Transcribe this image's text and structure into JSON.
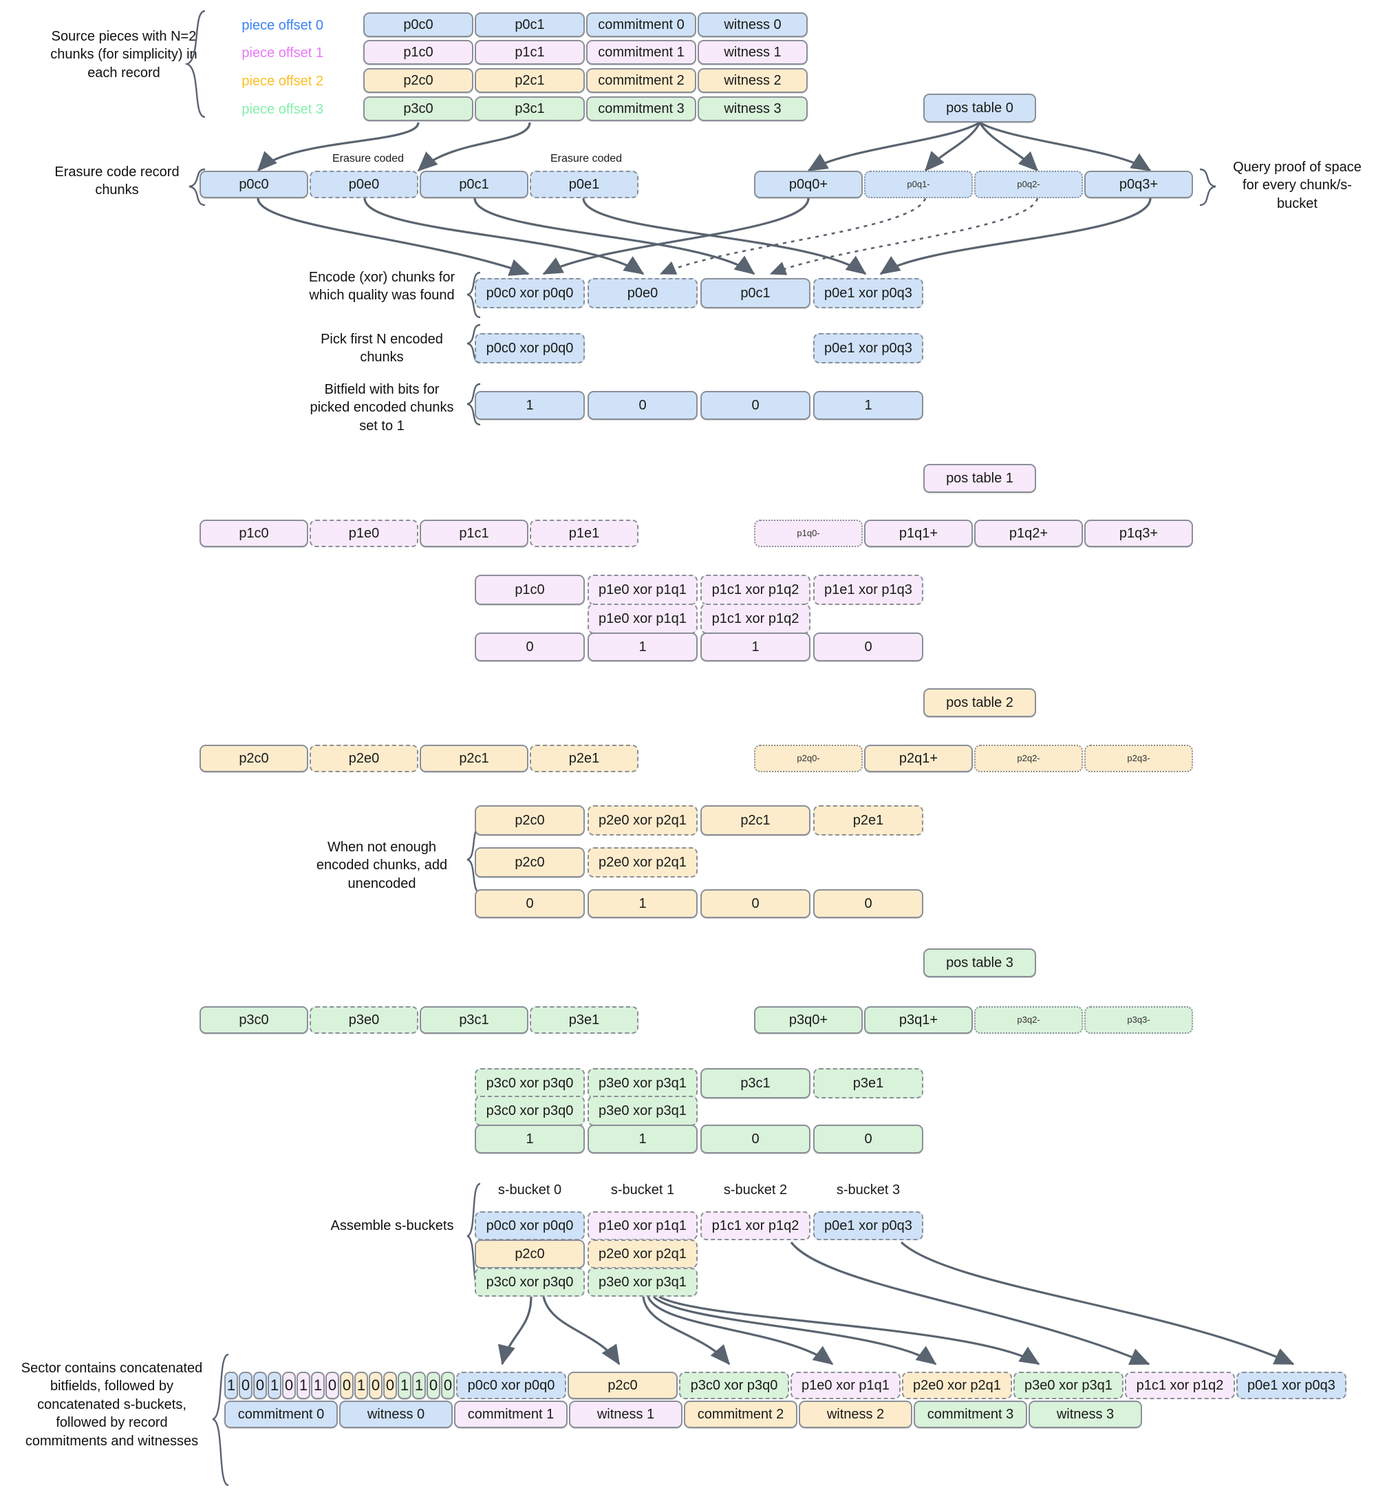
{
  "palette": {
    "blue": "#cfe2f7",
    "pink": "#f8eafa",
    "orange": "#fdeccc",
    "green": "#d9f2da",
    "stroke": "#8a8f98",
    "arrow": "#5a6470",
    "offset0_text": "#3b82f6",
    "offset1_text": "#e879f9",
    "offset2_text": "#fbbf24",
    "offset3_text": "#86efac"
  },
  "labels": {
    "source_pieces": "Source pieces with N=2 chunks (for simplicity) in each record",
    "erasure_code_record_chunks": "Erasure code record chunks",
    "query_proof_of_space": "Query proof of space for every chunk/s-bucket",
    "encode_xor": "Encode (xor) chunks for which quality was found",
    "pick_first_n": "Pick first N encoded chunks",
    "bitfield_label": "Bitfield with bits for picked encoded chunks set to 1",
    "when_not_enough": "When not enough encoded chunks, add unencoded",
    "assemble_s_buckets": "Assemble s-buckets",
    "sector_contains": "Sector contains concatenated bitfields, followed by concatenated s-buckets, followed by record commitments and witnesses",
    "erasure_coded": "Erasure coded"
  },
  "piece_offsets": [
    {
      "label": "piece offset 0",
      "color": "offset0_text"
    },
    {
      "label": "piece offset 1",
      "color": "offset1_text"
    },
    {
      "label": "piece offset 2",
      "color": "offset2_text"
    },
    {
      "label": "piece offset 3",
      "color": "offset3_text"
    }
  ],
  "records": [
    {
      "tone": "blue",
      "cells": [
        "p0c0",
        "p0c1",
        "commitment 0",
        "witness 0"
      ]
    },
    {
      "tone": "pink",
      "cells": [
        "p1c0",
        "p1c1",
        "commitment 1",
        "witness 1"
      ]
    },
    {
      "tone": "orange",
      "cells": [
        "p2c0",
        "p2c1",
        "commitment 2",
        "witness 2"
      ]
    },
    {
      "tone": "green",
      "cells": [
        "p3c0",
        "p3c1",
        "commitment 3",
        "witness 3"
      ]
    }
  ],
  "pos_tables": [
    {
      "label": "pos table 0",
      "tone": "blue"
    },
    {
      "label": "pos table 1",
      "tone": "pink"
    },
    {
      "label": "pos table 2",
      "tone": "orange"
    },
    {
      "label": "pos table 3",
      "tone": "green"
    }
  ],
  "groups": [
    {
      "id": "group0",
      "tone": "blue",
      "chunks": [
        {
          "text": "p0c0",
          "style": "solid"
        },
        {
          "text": "p0e0",
          "style": "dashed"
        },
        {
          "text": "p0c1",
          "style": "solid"
        },
        {
          "text": "p0e1",
          "style": "dashed"
        }
      ],
      "quality": [
        {
          "text": "p0q0+",
          "style": "solid",
          "size": "normal"
        },
        {
          "text": "p0q1-",
          "style": "dotted",
          "size": "small"
        },
        {
          "text": "p0q2-",
          "style": "dotted",
          "size": "small"
        },
        {
          "text": "p0q3+",
          "style": "solid",
          "size": "normal"
        }
      ],
      "encoded": [
        {
          "text": "p0c0 xor p0q0",
          "style": "dashed"
        },
        {
          "text": "p0e0",
          "style": "dashed"
        },
        {
          "text": "p0c1",
          "style": "solid"
        },
        {
          "text": "p0e1 xor p0q3",
          "style": "dashed"
        }
      ],
      "picked": [
        {
          "text": "p0c0 xor p0q0",
          "style": "dashed",
          "slot": 0
        },
        {
          "text": "p0e1 xor p0q3",
          "style": "dashed",
          "slot": 3
        }
      ],
      "bitfield": [
        "1",
        "0",
        "0",
        "1"
      ]
    },
    {
      "id": "group1",
      "tone": "pink",
      "chunks": [
        {
          "text": "p1c0",
          "style": "solid"
        },
        {
          "text": "p1e0",
          "style": "dashed"
        },
        {
          "text": "p1c1",
          "style": "solid"
        },
        {
          "text": "p1e1",
          "style": "dashed"
        }
      ],
      "quality": [
        {
          "text": "p1q0-",
          "style": "dotted",
          "size": "small"
        },
        {
          "text": "p1q1+",
          "style": "solid",
          "size": "normal"
        },
        {
          "text": "p1q2+",
          "style": "solid",
          "size": "normal"
        },
        {
          "text": "p1q3+",
          "style": "solid",
          "size": "normal"
        }
      ],
      "encoded": [
        {
          "text": "p1c0",
          "style": "solid"
        },
        {
          "text": "p1e0 xor p1q1",
          "style": "dashed"
        },
        {
          "text": "p1c1 xor p1q2",
          "style": "dashed"
        },
        {
          "text": "p1e1 xor p1q3",
          "style": "dashed"
        }
      ],
      "picked": [
        {
          "text": "p1e0 xor p1q1",
          "style": "dashed",
          "slot": 1
        },
        {
          "text": "p1c1 xor p1q2",
          "style": "dashed",
          "slot": 2
        }
      ],
      "bitfield": [
        "0",
        "1",
        "1",
        "0"
      ]
    },
    {
      "id": "group2",
      "tone": "orange",
      "chunks": [
        {
          "text": "p2c0",
          "style": "solid"
        },
        {
          "text": "p2e0",
          "style": "dashed"
        },
        {
          "text": "p2c1",
          "style": "solid"
        },
        {
          "text": "p2e1",
          "style": "dashed"
        }
      ],
      "quality": [
        {
          "text": "p2q0-",
          "style": "dotted",
          "size": "small"
        },
        {
          "text": "p2q1+",
          "style": "solid",
          "size": "normal"
        },
        {
          "text": "p2q2-",
          "style": "dotted",
          "size": "small"
        },
        {
          "text": "p2q3-",
          "style": "dotted",
          "size": "small"
        }
      ],
      "encoded": [
        {
          "text": "p2c0",
          "style": "solid"
        },
        {
          "text": "p2e0 xor p2q1",
          "style": "dashed"
        },
        {
          "text": "p2c1",
          "style": "solid"
        },
        {
          "text": "p2e1",
          "style": "dashed"
        }
      ],
      "picked": [
        {
          "text": "p2c0",
          "style": "solid",
          "slot": 0
        },
        {
          "text": "p2e0 xor p2q1",
          "style": "dashed",
          "slot": 1
        }
      ],
      "bitfield": [
        "0",
        "1",
        "0",
        "0"
      ]
    },
    {
      "id": "group3",
      "tone": "green",
      "chunks": [
        {
          "text": "p3c0",
          "style": "solid"
        },
        {
          "text": "p3e0",
          "style": "dashed"
        },
        {
          "text": "p3c1",
          "style": "solid"
        },
        {
          "text": "p3e1",
          "style": "dashed"
        }
      ],
      "quality": [
        {
          "text": "p3q0+",
          "style": "solid",
          "size": "normal"
        },
        {
          "text": "p3q1+",
          "style": "solid",
          "size": "normal"
        },
        {
          "text": "p3q2-",
          "style": "dotted",
          "size": "small"
        },
        {
          "text": "p3q3-",
          "style": "dotted",
          "size": "small"
        }
      ],
      "encoded": [
        {
          "text": "p3c0 xor p3q0",
          "style": "dashed"
        },
        {
          "text": "p3e0 xor p3q1",
          "style": "dashed"
        },
        {
          "text": "p3c1",
          "style": "solid"
        },
        {
          "text": "p3e1",
          "style": "dashed"
        }
      ],
      "picked": [
        {
          "text": "p3c0 xor p3q0",
          "style": "dashed",
          "slot": 0
        },
        {
          "text": "p3e0 xor p3q1",
          "style": "dashed",
          "slot": 1
        }
      ],
      "bitfield": [
        "1",
        "1",
        "0",
        "0"
      ]
    }
  ],
  "s_buckets": {
    "headers": [
      "s-bucket 0",
      "s-bucket 1",
      "s-bucket 2",
      "s-bucket 3"
    ],
    "rows": [
      [
        {
          "text": "p0c0 xor p0q0",
          "tone": "blue",
          "style": "dashed"
        },
        {
          "text": "p1e0 xor p1q1",
          "tone": "pink",
          "style": "dashed"
        },
        {
          "text": "p1c1  xor p1q2",
          "tone": "pink",
          "style": "dashed"
        },
        {
          "text": "p0e1 xor p0q3",
          "tone": "blue",
          "style": "dashed"
        }
      ],
      [
        {
          "text": "p2c0",
          "tone": "orange",
          "style": "solid"
        },
        {
          "text": "p2e0 xor p2q1",
          "tone": "orange",
          "style": "dashed"
        }
      ],
      [
        {
          "text": "p3c0 xor p3q0",
          "tone": "green",
          "style": "dashed"
        },
        {
          "text": "p3e0 xor p3q1",
          "tone": "green",
          "style": "dashed"
        }
      ]
    ]
  },
  "sector": {
    "bitfield": [
      {
        "bit": "1",
        "tone": "blue"
      },
      {
        "bit": "0",
        "tone": "blue"
      },
      {
        "bit": "0",
        "tone": "blue"
      },
      {
        "bit": "1",
        "tone": "blue"
      },
      {
        "bit": "0",
        "tone": "pink"
      },
      {
        "bit": "1",
        "tone": "pink"
      },
      {
        "bit": "1",
        "tone": "pink"
      },
      {
        "bit": "0",
        "tone": "pink"
      },
      {
        "bit": "0",
        "tone": "orange"
      },
      {
        "bit": "1",
        "tone": "orange"
      },
      {
        "bit": "0",
        "tone": "orange"
      },
      {
        "bit": "0",
        "tone": "orange"
      },
      {
        "bit": "1",
        "tone": "green"
      },
      {
        "bit": "1",
        "tone": "green"
      },
      {
        "bit": "0",
        "tone": "green"
      },
      {
        "bit": "0",
        "tone": "green"
      }
    ],
    "chunks": [
      {
        "text": "p0c0 xor p0q0",
        "tone": "blue",
        "style": "dashed"
      },
      {
        "text": "p2c0",
        "tone": "orange",
        "style": "solid"
      },
      {
        "text": "p3c0 xor p3q0",
        "tone": "green",
        "style": "dashed"
      },
      {
        "text": "p1e0 xor p1q1",
        "tone": "pink",
        "style": "dashed"
      },
      {
        "text": "p2e0 xor p2q1",
        "tone": "orange",
        "style": "dashed"
      },
      {
        "text": "p3e0 xor p3q1",
        "tone": "green",
        "style": "dashed"
      },
      {
        "text": "p1c1 xor p1q2",
        "tone": "pink",
        "style": "dashed"
      },
      {
        "text": "p0e1 xor p0q3",
        "tone": "blue",
        "style": "dashed"
      }
    ],
    "tail": [
      {
        "text": "commitment 0",
        "tone": "blue"
      },
      {
        "text": "witness 0",
        "tone": "blue"
      },
      {
        "text": "commitment 1",
        "tone": "pink"
      },
      {
        "text": "witness 1",
        "tone": "pink"
      },
      {
        "text": "commitment 2",
        "tone": "orange"
      },
      {
        "text": "witness 2",
        "tone": "orange"
      },
      {
        "text": "commitment 3",
        "tone": "green"
      },
      {
        "text": "witness 3",
        "tone": "green"
      }
    ]
  }
}
